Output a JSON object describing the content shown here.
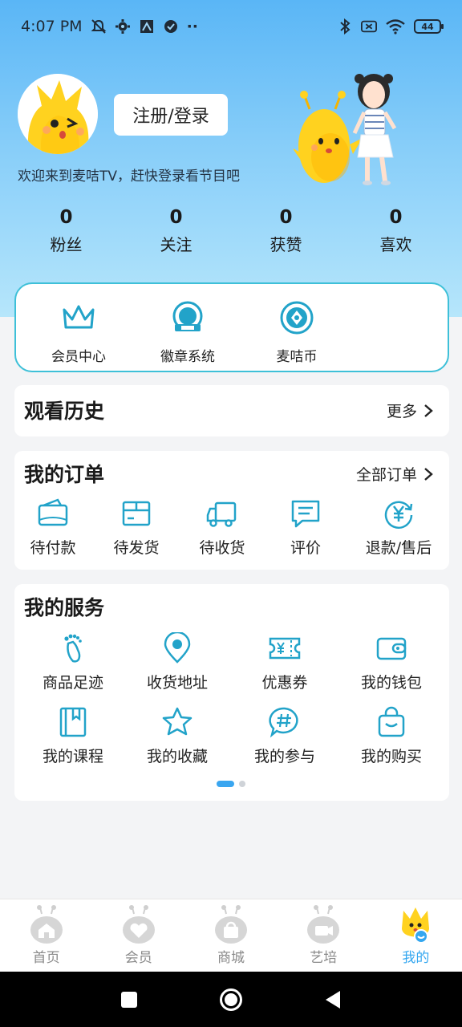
{
  "status_bar": {
    "time": "4:07 PM",
    "dots": "··",
    "battery": "44",
    "icons": [
      "mute-icon",
      "gear-icon",
      "app-icon",
      "check-circle-icon",
      "bluetooth-icon",
      "no-sim-icon",
      "wifi-icon",
      "battery-icon"
    ]
  },
  "profile": {
    "login_label": "注册/登录",
    "welcome": "欢迎来到麦咭TV，赶快登录看节目吧",
    "stats": [
      {
        "value": "0",
        "label": "粉丝"
      },
      {
        "value": "0",
        "label": "关注"
      },
      {
        "value": "0",
        "label": "获赞"
      },
      {
        "value": "0",
        "label": "喜欢"
      }
    ]
  },
  "member": {
    "items": [
      {
        "label": "会员中心",
        "icon": "crown-icon"
      },
      {
        "label": "徽章系统",
        "icon": "badge-icon"
      },
      {
        "label": "麦咭币",
        "icon": "coin-icon"
      }
    ]
  },
  "history": {
    "title": "观看历史",
    "more": "更多"
  },
  "orders": {
    "title": "我的订单",
    "more": "全部订单",
    "items": [
      {
        "label": "待付款",
        "icon": "wallet-icon"
      },
      {
        "label": "待发货",
        "icon": "package-icon"
      },
      {
        "label": "待收货",
        "icon": "truck-icon"
      },
      {
        "label": "评价",
        "icon": "comment-icon"
      },
      {
        "label": "退款/售后",
        "icon": "refund-icon"
      }
    ]
  },
  "services": {
    "title": "我的服务",
    "row1": [
      {
        "label": "商品足迹",
        "icon": "footprint-icon"
      },
      {
        "label": "收货地址",
        "icon": "location-icon"
      },
      {
        "label": "优惠券",
        "icon": "coupon-icon"
      },
      {
        "label": "我的钱包",
        "icon": "purse-icon"
      }
    ],
    "row2": [
      {
        "label": "我的课程",
        "icon": "book-icon"
      },
      {
        "label": "我的收藏",
        "icon": "star-icon"
      },
      {
        "label": "我的参与",
        "icon": "hashtag-icon"
      },
      {
        "label": "我的购买",
        "icon": "shopping-bag-icon"
      }
    ],
    "page_count": 2,
    "active_page": 1
  },
  "bottom_nav": {
    "items": [
      {
        "label": "首页",
        "icon": "home-icon"
      },
      {
        "label": "会员",
        "icon": "member-heart-icon"
      },
      {
        "label": "商城",
        "icon": "mall-bag-icon"
      },
      {
        "label": "艺培",
        "icon": "video-icon"
      },
      {
        "label": "我的",
        "icon": "profile-mascot-icon"
      }
    ],
    "active": "我的"
  },
  "colors": {
    "accent": "#34a7f0",
    "icon_teal": "#22a3c9",
    "member_border": "#3ec0d8",
    "header_top": "#5ab6f6",
    "header_bottom": "#b6e6fb"
  }
}
